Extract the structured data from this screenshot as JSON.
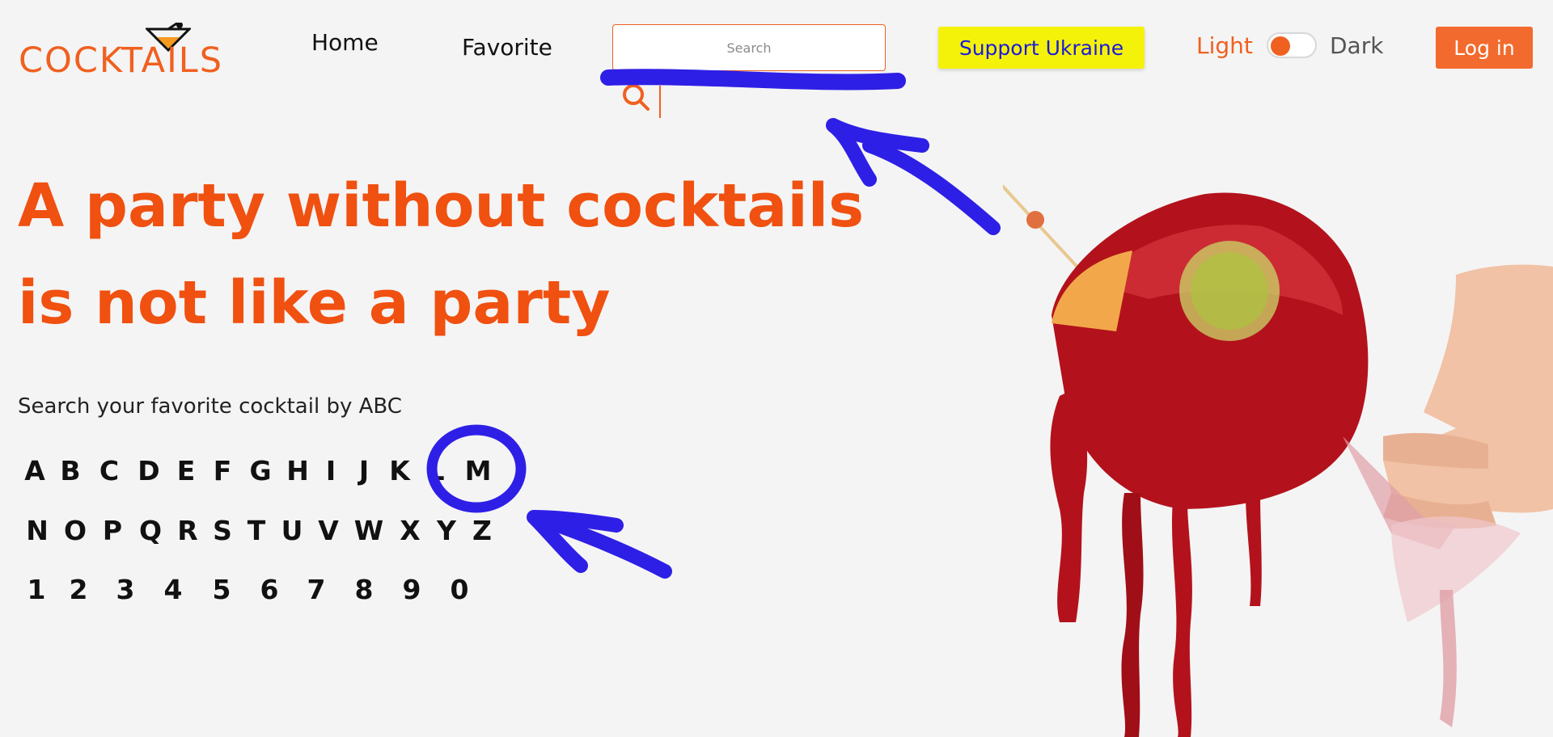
{
  "header": {
    "logo_text": "COCKTAILS",
    "nav": [
      {
        "label": "Home"
      },
      {
        "label": "Favorite"
      }
    ],
    "search": {
      "placeholder": "Search",
      "value": ""
    },
    "support_label": "Support Ukraine",
    "theme": {
      "light_label": "Light",
      "dark_label": "Dark",
      "active": "light"
    },
    "login_label": "Log in"
  },
  "hero": {
    "headline_line1": "A party without cocktails",
    "headline_line2": "is not like a party"
  },
  "abc": {
    "label": "Search your favorite cocktail by ABC",
    "rows": [
      [
        "A",
        "B",
        "C",
        "D",
        "E",
        "F",
        "G",
        "H",
        "I",
        "J",
        "K",
        "L",
        "M"
      ],
      [
        "N",
        "O",
        "P",
        "Q",
        "R",
        "S",
        "T",
        "U",
        "V",
        "W",
        "X",
        "Y",
        "Z"
      ],
      [
        "1",
        "2",
        "3",
        "4",
        "5",
        "6",
        "7",
        "8",
        "9",
        "0"
      ]
    ]
  },
  "colors": {
    "accent": "#f06020",
    "support_bg": "#f5f20a",
    "support_text": "#1a1adb",
    "annotation": "#2e1fe6"
  }
}
